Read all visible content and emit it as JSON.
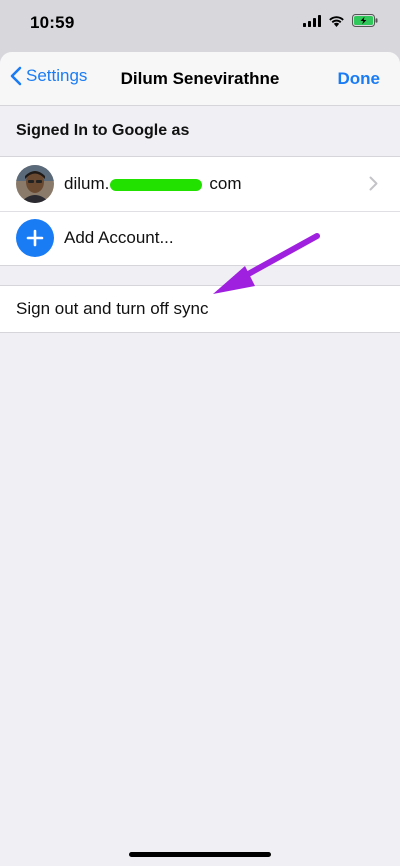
{
  "status": {
    "time": "10:59"
  },
  "nav": {
    "back_label": "Settings",
    "title": "Dilum Senevirathne",
    "done_label": "Done"
  },
  "section": {
    "header": "Signed In to Google as"
  },
  "account": {
    "email_prefix": "dilum.",
    "email_suffix": "com"
  },
  "add_account": {
    "label": "Add Account..."
  },
  "signout": {
    "label": "Sign out and turn off sync"
  },
  "colors": {
    "accent": "#1a7cf5",
    "annotation_arrow": "#a020e0",
    "redaction": "#22e000"
  },
  "icons": [
    "chevron-left-icon",
    "chevron-right-icon",
    "plus-icon",
    "signal-icon",
    "wifi-icon",
    "battery-icon"
  ]
}
